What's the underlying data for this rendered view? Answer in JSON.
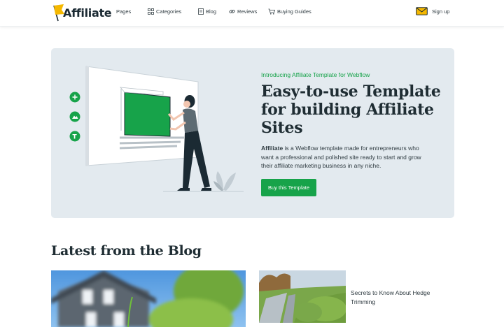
{
  "brand": {
    "name": "Affiliate"
  },
  "nav": {
    "items": [
      {
        "label": "Pages",
        "icon": "none"
      },
      {
        "label": "Categories",
        "icon": "grid-icon"
      },
      {
        "label": "Blog",
        "icon": "document-icon"
      },
      {
        "label": "Reviews",
        "icon": "link-icon"
      },
      {
        "label": "Buying Guides",
        "icon": "cart-icon"
      }
    ],
    "signup": {
      "label": "Sign up",
      "icon": "envelope-icon"
    }
  },
  "hero": {
    "eyebrow": "Introducing Affiliate Template for Webflow",
    "title": "Easy-to-use Template for building Affiliate Sites",
    "description_bold": "Affiliate",
    "description_rest": " is a Webflow template made for entrepreneurs who want a professional and polished site ready to start and grow their affiliate marketing business in any niche.",
    "button": "Buy this Template"
  },
  "blog": {
    "heading": "Latest from the Blog",
    "posts": [
      {
        "title": ""
      },
      {
        "title": "Secrets to Know About Hedge Trimming"
      }
    ]
  },
  "colors": {
    "accent": "#17a34a",
    "hero_bg": "#e3eaef",
    "text": "#1f2d33"
  }
}
